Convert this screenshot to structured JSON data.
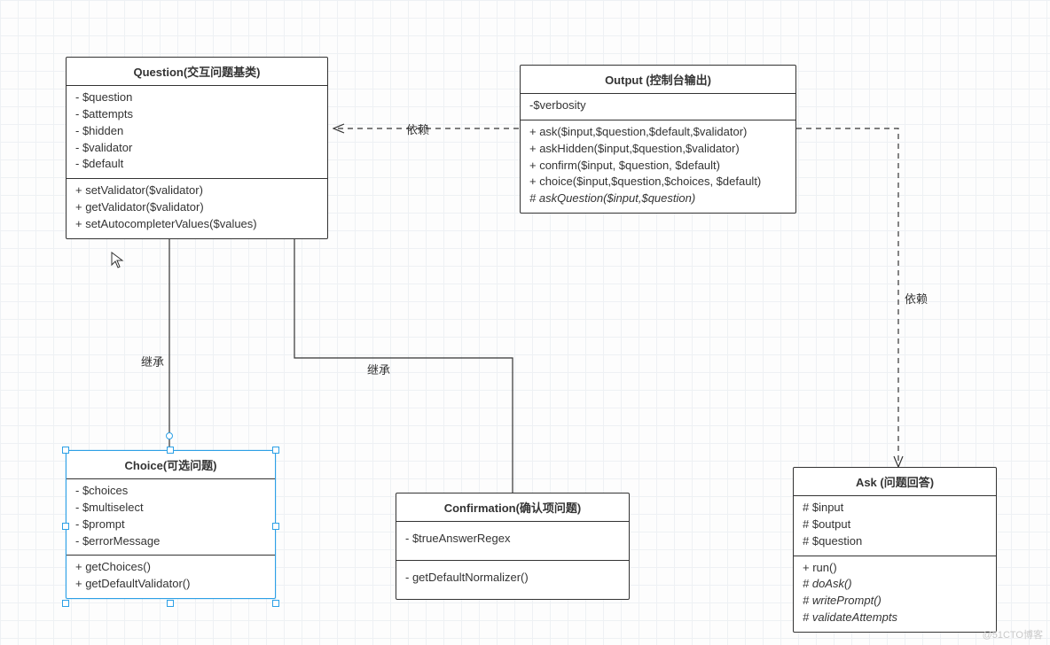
{
  "classes": {
    "question": {
      "title": "Question(交互问题基类)",
      "attrs": [
        "- $question",
        "- $attempts",
        "- $hidden",
        "- $validator",
        "- $default"
      ],
      "ops": [
        "+ setValidator($validator)",
        "+ getValidator($validator)",
        "+ setAutocompleterValues($values)"
      ]
    },
    "output": {
      "title": "Output (控制台输出)",
      "attrs": [
        "-$verbosity"
      ],
      "ops": [
        "+ ask($input,$question,$default,$validator)",
        "+ askHidden($input,$question,$validator)",
        "+ confirm($input, $question, $default)",
        "+ choice($input,$question,$choices, $default)",
        "# askQuestion($input,$question)"
      ],
      "italicOpIndex": 4
    },
    "choice": {
      "title": "Choice(可选问题)",
      "attrs": [
        "- $choices",
        "- $multiselect",
        "- $prompt",
        "- $errorMessage"
      ],
      "ops": [
        "+ getChoices()",
        "+ getDefaultValidator()"
      ]
    },
    "confirmation": {
      "title": "Confirmation(确认项问题)",
      "attrs": [
        "- $trueAnswerRegex"
      ],
      "ops": [
        "- getDefaultNormalizer()"
      ]
    },
    "ask": {
      "title": "Ask (问题回答)",
      "attrs": [
        "# $input",
        "# $output",
        "# $question"
      ],
      "ops": [
        "+ run()",
        "# doAsk()",
        "# writePrompt()",
        "# validateAttempts"
      ],
      "italicOps": [
        1,
        2,
        3
      ]
    }
  },
  "labels": {
    "depend1": "依赖",
    "depend2": "依赖",
    "inherit1": "继承",
    "inherit2": "继承"
  },
  "watermark": "@51CTO博客",
  "cursor_glyph": "↖",
  "chart_data": {
    "type": "uml_class_diagram",
    "nodes": [
      {
        "id": "Question",
        "stereotype": "交互问题基类",
        "attributes": [
          "- $question",
          "- $attempts",
          "- $hidden",
          "- $validator",
          "- $default"
        ],
        "operations": [
          "+ setValidator($validator)",
          "+ getValidator($validator)",
          "+ setAutocompleterValues($values)"
        ]
      },
      {
        "id": "Output",
        "stereotype": "控制台输出",
        "attributes": [
          "- $verbosity"
        ],
        "operations": [
          "+ ask($input,$question,$default,$validator)",
          "+ askHidden($input,$question,$validator)",
          "+ confirm($input,$question,$default)",
          "+ choice($input,$question,$choices,$default)",
          "# askQuestion($input,$question)  {abstract}"
        ]
      },
      {
        "id": "Choice",
        "stereotype": "可选问题",
        "attributes": [
          "- $choices",
          "- $multiselect",
          "- $prompt",
          "- $errorMessage"
        ],
        "operations": [
          "+ getChoices()",
          "+ getDefaultValidator()"
        ]
      },
      {
        "id": "Confirmation",
        "stereotype": "确认项问题",
        "attributes": [
          "- $trueAnswerRegex"
        ],
        "operations": [
          "- getDefaultNormalizer()"
        ]
      },
      {
        "id": "Ask",
        "stereotype": "问题回答",
        "attributes": [
          "# $input",
          "# $output",
          "# $question"
        ],
        "operations": [
          "+ run()",
          "# doAsk() {abstract}",
          "# writePrompt() {abstract}",
          "# validateAttempts {abstract}"
        ]
      }
    ],
    "edges": [
      {
        "from": "Choice",
        "to": "Question",
        "type": "generalization",
        "label": "继承"
      },
      {
        "from": "Confirmation",
        "to": "Question",
        "type": "generalization",
        "label": "继承"
      },
      {
        "from": "Output",
        "to": "Question",
        "type": "dependency",
        "label": "依赖"
      },
      {
        "from": "Output",
        "to": "Ask",
        "type": "dependency",
        "label": "依赖"
      }
    ]
  }
}
